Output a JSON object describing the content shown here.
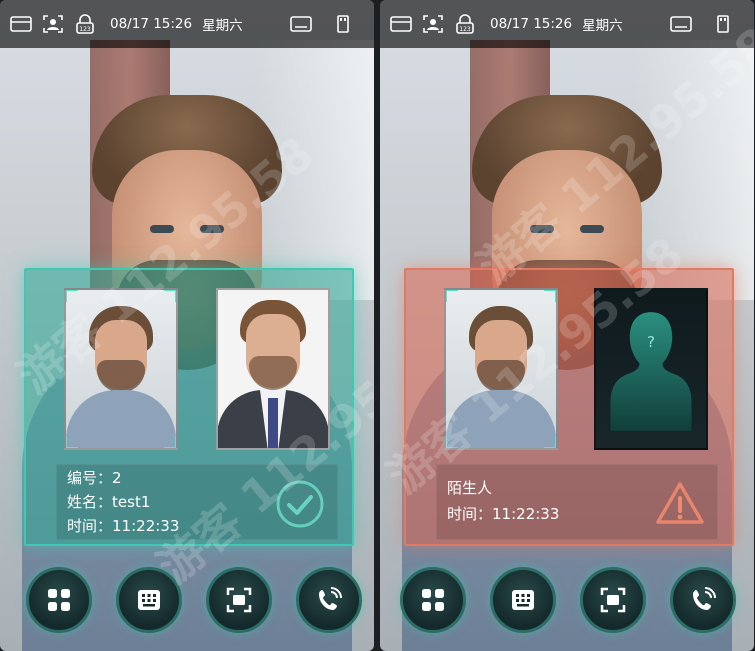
{
  "panels": [
    {
      "status": {
        "datetime": "08/17 15:26",
        "weekday": "星期六"
      },
      "result": "matched",
      "info": {
        "id_label": "编号：",
        "id_value": "2",
        "name_label": "姓名：",
        "name_value": "test1",
        "time_label": "时间：",
        "time_value": "11:22:33"
      }
    },
    {
      "status": {
        "datetime": "08/17 15:26",
        "weekday": "星期六"
      },
      "result": "stranger",
      "info": {
        "label": "陌生人",
        "time_label": "时间：",
        "time_value": "11:22:33"
      }
    }
  ],
  "buttons": [
    "grid-menu-icon",
    "keypad-icon",
    "face-scan-icon",
    "intercom-call-icon"
  ],
  "colors": {
    "match_accent": "#3ec9b2",
    "stranger_accent": "#e07a62",
    "button_ring": "#2c6e66"
  },
  "watermark": "游客 112.95.58"
}
